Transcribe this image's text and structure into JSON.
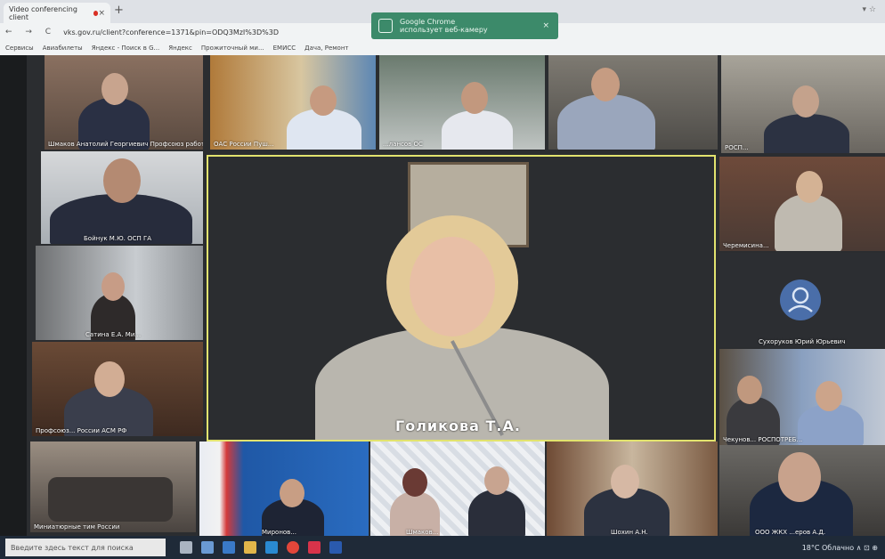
{
  "browser": {
    "tab_title": "Video conferencing client",
    "tab_close": "×",
    "new_tab": "+",
    "nav": "← → C",
    "url": "vks.gov.ru/client?conference=1371&pin=ODQ3MzI%3D%3D",
    "bookmarks": [
      "Сервисы",
      "Авиабилеты",
      "Яндекс - Поиск в G...",
      "Яндекс",
      "Прожиточный ми...",
      "ЕМИСС",
      "Дача, Ремонт"
    ],
    "window_controls": "▾ ☆",
    "toast_title": "Google Chrome",
    "toast_text": "использует веб-камеру",
    "toast_close": "×"
  },
  "participants": {
    "p1": "Шмаков Анатолий Георгиевич Профсоюз работ",
    "p2": "ОАС России Пуш...",
    "p3": "...лансов ОС",
    "p4": "",
    "p5": "РОСП...",
    "p6": "Бойнук М.Ю.  ОСП ГА",
    "p7": "Сатина Е.А. Ми...",
    "p8": "Профсоюз... России АСМ РФ",
    "p9": "Черемисина...",
    "p10": "Сухоруков Юрий Юрьевич",
    "p11": "Чекунов... РОСПОТРЕБ...",
    "p12": "Миниатюрные тим России",
    "p13": "Миронов...",
    "p14": "Шмаков...",
    "p15": "Шохин А.Н.",
    "p16": "ООО ЖКХ ...еров А.Д."
  },
  "speaker": {
    "name": "Голикова Т.А."
  },
  "taskbar": {
    "search_placeholder": "Введите здесь текст для поиска",
    "tray": "18°C  Облачно  ∧  ⊡  ⊕"
  }
}
